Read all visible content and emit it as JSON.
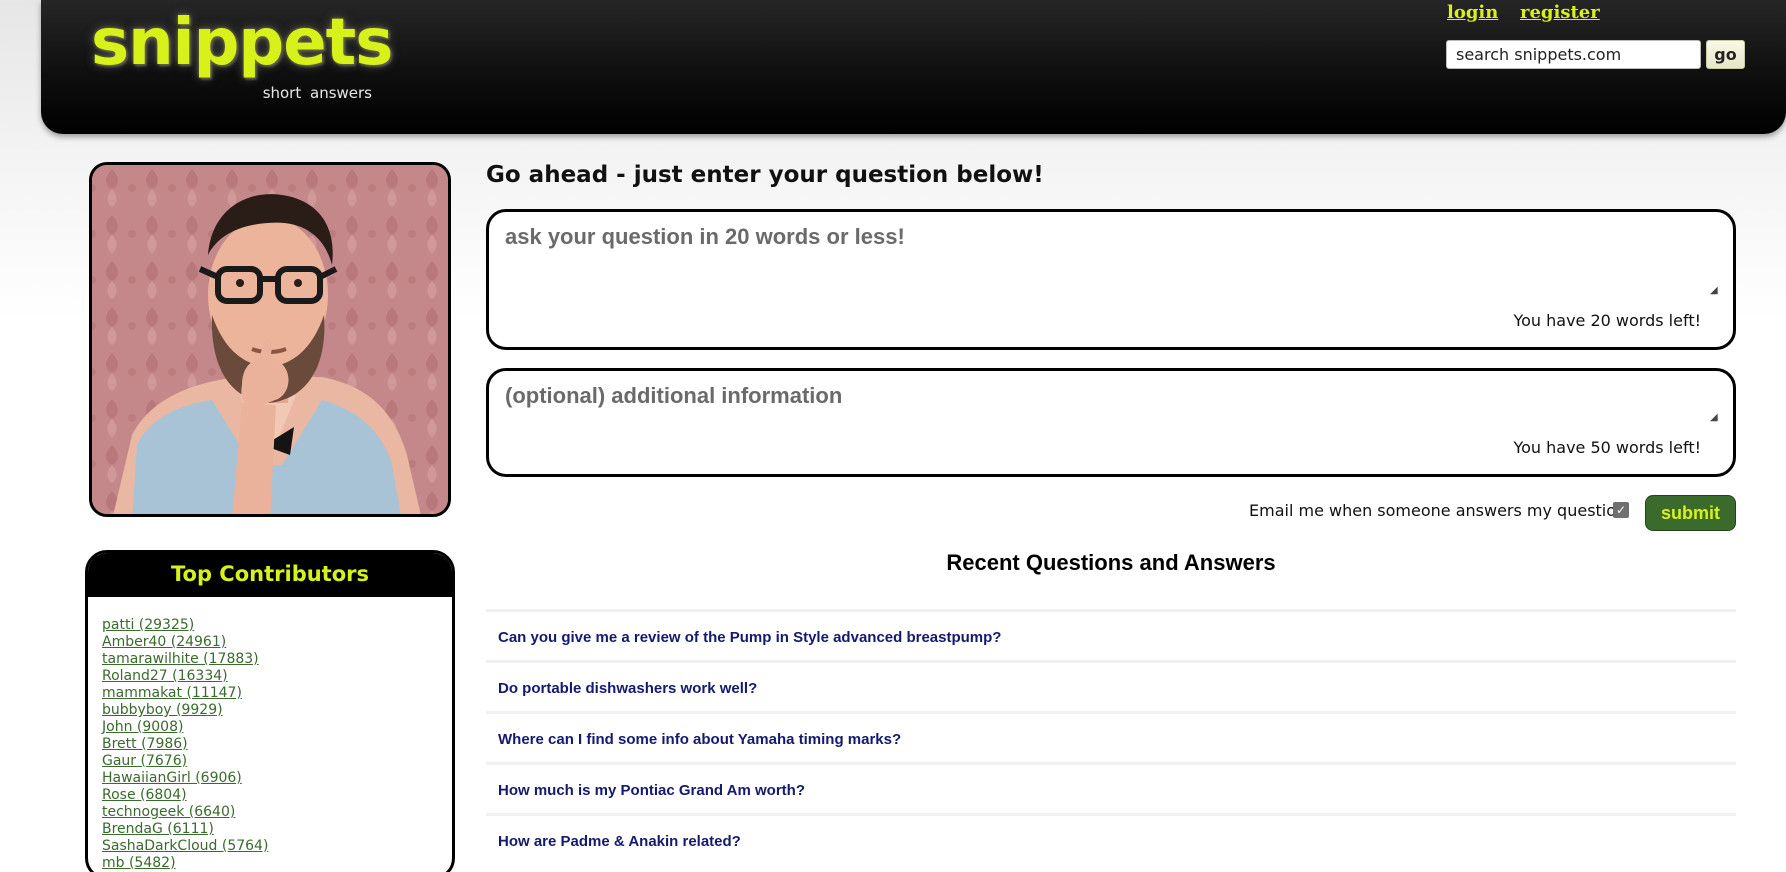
{
  "header": {
    "logo_text": "snippets",
    "logo_tagline": "short answers",
    "login_label": "login",
    "register_label": "register",
    "search_value": "search snippets.com",
    "search_button": "go"
  },
  "sidebar": {
    "photo_alt": "thinking man with glasses",
    "contributors_title": "Top Contributors",
    "contributors": [
      "patti (29325)",
      "Amber40 (24961)",
      "tamarawilhite (17883)",
      "Roland27 (16334)",
      "mammakat (11147)",
      "bubbyboy (9929)",
      "John (9008)",
      "Brett (7986)",
      "Gaur (7676)",
      "HawaiianGirl (6906)",
      "Rose (6804)",
      "technogeek (6640)",
      "BrendaG (6111)",
      "SashaDarkCloud (5764)",
      "mb (5482)"
    ]
  },
  "main": {
    "title": "Go ahead - just enter your question below!",
    "question_placeholder": "ask your question in 20 words or less!",
    "question_words_left": "You have 20 words left!",
    "info_placeholder": "(optional) additional information",
    "info_words_left": "You have 50 words left!",
    "email_label": "Email me when someone answers my question",
    "email_checked": true,
    "submit_label": "submit",
    "recent_title": "Recent Questions and Answers",
    "recent_questions": [
      "Can you give me a review of the Pump in Style advanced breastpump?",
      "Do portable dishwashers work well?",
      "Where can I find some info about Yamaha timing marks?",
      "How much is my Pontiac Grand Am worth?",
      "How are Padme & Anakin related?"
    ]
  },
  "colors": {
    "accent_yellow": "#d7f21a",
    "submit_green": "#3b6b2c",
    "contributor_link": "#3a6a2e",
    "question_link": "#141a6e"
  }
}
